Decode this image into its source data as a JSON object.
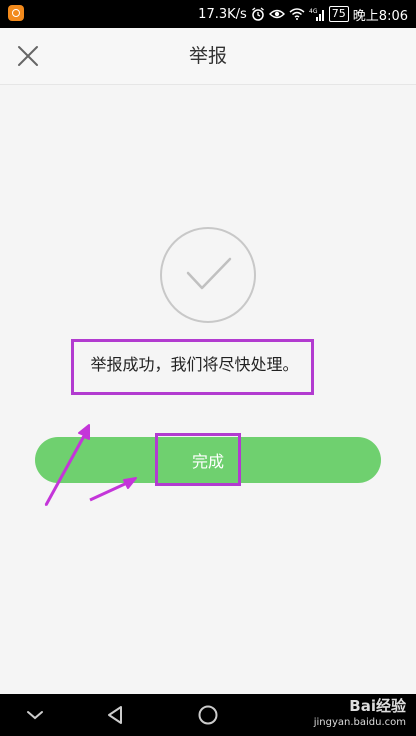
{
  "status_bar": {
    "speed": "17.3K/s",
    "network": "4G",
    "battery": "75",
    "time": "晚上8:06",
    "icons": [
      "app-notification-icon",
      "alarm-icon",
      "eye-icon",
      "wifi-icon",
      "signal-icon",
      "battery-icon"
    ]
  },
  "header": {
    "title": "举报",
    "close_icon": "close-icon"
  },
  "main": {
    "success_icon": "check-circle-icon",
    "message": "举报成功，我们将尽快处理。",
    "done_button_label": "完成",
    "button_color": "#6fd06f",
    "highlight_color": "#b23bd0"
  },
  "nav_bar": {
    "icons": [
      "chevron-down-icon",
      "back-icon",
      "home-icon"
    ]
  },
  "watermark": {
    "logo_text": "Bai经验",
    "url": "jingyan.baidu.com"
  }
}
